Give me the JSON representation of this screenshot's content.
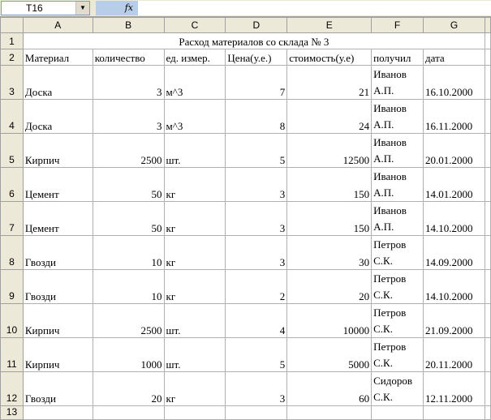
{
  "formula_bar": {
    "name_box": "T16",
    "fx_label": "fx",
    "content": ""
  },
  "columns": [
    "A",
    "B",
    "C",
    "D",
    "E",
    "F",
    "G"
  ],
  "title": "Расход материалов со склада № 3",
  "headers": [
    "Материал",
    "количество",
    "ед. измер.",
    "Цена(у.е.)",
    "стоимость(у.е)",
    "получил",
    "дата"
  ],
  "row_numbers": [
    "1",
    "2",
    "3",
    "4",
    "5",
    "6",
    "7",
    "8",
    "9",
    "10",
    "11",
    "12",
    "13"
  ],
  "rows": [
    [
      "Доска",
      "3",
      "м^3",
      "7",
      "21",
      "Иванов А.П.",
      "16.10.2000"
    ],
    [
      "Доска",
      "3",
      "м^3",
      "8",
      "24",
      "Иванов А.П.",
      "16.11.2000"
    ],
    [
      "Кирпич",
      "2500",
      "шт.",
      "5",
      "12500",
      "Иванов А.П.",
      "20.01.2000"
    ],
    [
      "Цемент",
      "50",
      "кг",
      "3",
      "150",
      "Иванов А.П.",
      "14.01.2000"
    ],
    [
      "Цемент",
      "50",
      "кг",
      "3",
      "150",
      "Иванов А.П.",
      "14.10.2000"
    ],
    [
      "Гвозди",
      "10",
      "кг",
      "3",
      "30",
      "Петров С.К.",
      "14.09.2000"
    ],
    [
      "Гвозди",
      "10",
      "кг",
      "2",
      "20",
      "Петров С.К.",
      "14.10.2000"
    ],
    [
      "Кирпич",
      "2500",
      "шт.",
      "4",
      "10000",
      "Петров С.К.",
      "21.09.2000"
    ],
    [
      "Кирпич",
      "1000",
      "шт.",
      "5",
      "5000",
      "Петров С.К.",
      "20.11.2000"
    ],
    [
      "Гвозди",
      "20",
      "кг",
      "3",
      "60",
      "Сидоров С.К.",
      "12.11.2000"
    ]
  ]
}
